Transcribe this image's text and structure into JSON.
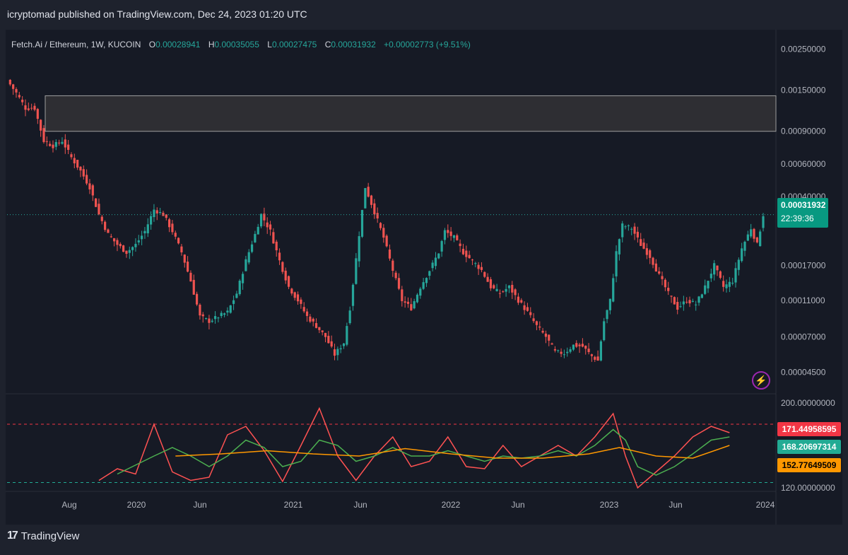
{
  "header": {
    "publisher": "icryptomad published on TradingView.com, Dec 24, 2023 01:20 UTC"
  },
  "legend": {
    "symbol": "Fetch.Ai / Ethereum, 1W, KUCOIN",
    "open_label": "O",
    "open": "0.00028941",
    "high_label": "H",
    "high": "0.00035055",
    "low_label": "L",
    "low": "0.00027475",
    "close_label": "C",
    "close": "0.00031932",
    "change": "+0.00002773 (+9.51%)"
  },
  "price_scale": {
    "last_price": "0.00031932",
    "countdown": "22:39:36"
  },
  "indicator_scale": {
    "boxes": [
      "171.44958595",
      "168.20697314",
      "152.77649509"
    ]
  },
  "footer": {
    "logo": "TradingView"
  },
  "colors": {
    "up": "#26a69a",
    "down": "#ef5350",
    "ind1": "#ff5252",
    "ind2": "#4caf50",
    "ind3": "#ff9800",
    "zone": "#2e2e33"
  },
  "chart_data": [
    {
      "type": "candlestick",
      "scale": "log",
      "ylim": [
        4e-05,
        0.0026
      ],
      "y_ticks": [
        "0.00250000",
        "0.00150000",
        "0.00090000",
        "0.00060000",
        "0.00040000",
        "0.00017000",
        "0.00011000",
        "0.00007000",
        "0.00004500"
      ],
      "x_ticks": [
        "Aug",
        "2020",
        "Jun",
        "2021",
        "Jun",
        "2022",
        "Jun",
        "2023",
        "Jun",
        "2024"
      ],
      "zone": [
        0.0009,
        0.0014
      ],
      "close_path": [
        [
          0,
          0.0017
        ],
        [
          3,
          0.00145
        ],
        [
          6,
          0.0012
        ],
        [
          9,
          0.0012
        ],
        [
          12,
          0.0008
        ],
        [
          15,
          0.00075
        ],
        [
          18,
          0.0008
        ],
        [
          21,
          0.00065
        ],
        [
          24,
          0.00055
        ],
        [
          27,
          0.00045
        ],
        [
          30,
          0.00032
        ],
        [
          33,
          0.00025
        ],
        [
          36,
          0.00022
        ],
        [
          39,
          0.0002
        ],
        [
          42,
          0.00022
        ],
        [
          45,
          0.00026
        ],
        [
          48,
          0.00034
        ],
        [
          51,
          0.00032
        ],
        [
          54,
          0.00026
        ],
        [
          57,
          0.0002
        ],
        [
          60,
          0.00014
        ],
        [
          63,
          9e-05
        ],
        [
          66,
          8.5e-05
        ],
        [
          69,
          9e-05
        ],
        [
          72,
          9.5e-05
        ],
        [
          75,
          0.00012
        ],
        [
          78,
          0.00018
        ],
        [
          81,
          0.00025
        ],
        [
          83,
          0.00032
        ],
        [
          86,
          0.00026
        ],
        [
          89,
          0.00018
        ],
        [
          92,
          0.00013
        ],
        [
          95,
          0.00011
        ],
        [
          98,
          9e-05
        ],
        [
          101,
          8e-05
        ],
        [
          104,
          7e-05
        ],
        [
          107,
          5.6e-05
        ],
        [
          110,
          6.5e-05
        ],
        [
          112,
          0.0001
        ],
        [
          115,
          0.00025
        ],
        [
          117,
          0.00045
        ],
        [
          120,
          0.00033
        ],
        [
          123,
          0.00024
        ],
        [
          126,
          0.00016
        ],
        [
          129,
          0.00011
        ],
        [
          132,
          0.0001
        ],
        [
          135,
          0.00013
        ],
        [
          138,
          0.00016
        ],
        [
          141,
          0.0002
        ],
        [
          143,
          0.00026
        ],
        [
          146,
          0.00024
        ],
        [
          149,
          0.0002
        ],
        [
          152,
          0.00018
        ],
        [
          155,
          0.00016
        ],
        [
          158,
          0.00013
        ],
        [
          161,
          0.00012
        ],
        [
          164,
          0.00013
        ],
        [
          167,
          0.00011
        ],
        [
          170,
          9.5e-05
        ],
        [
          173,
          8e-05
        ],
        [
          176,
          7e-05
        ],
        [
          179,
          5.8e-05
        ],
        [
          182,
          5.7e-05
        ],
        [
          185,
          6.3e-05
        ],
        [
          188,
          6.2e-05
        ],
        [
          191,
          5.5e-05
        ],
        [
          193,
          5.2e-05
        ],
        [
          195,
          8.5e-05
        ],
        [
          197,
          0.00011
        ],
        [
          199,
          0.0002
        ],
        [
          201,
          0.00028
        ],
        [
          204,
          0.00027
        ],
        [
          207,
          0.00022
        ],
        [
          210,
          0.00019
        ],
        [
          213,
          0.00015
        ],
        [
          216,
          0.00012
        ],
        [
          219,
          0.0001
        ],
        [
          222,
          0.00011
        ],
        [
          225,
          0.000105
        ],
        [
          228,
          0.00013
        ],
        [
          231,
          0.00017
        ],
        [
          234,
          0.00013
        ],
        [
          237,
          0.00014
        ],
        [
          240,
          0.00021
        ],
        [
          243,
          0.00027
        ],
        [
          245,
          0.00022
        ],
        [
          247,
          0.00031932
        ]
      ],
      "last": 0.00031932
    },
    {
      "type": "line",
      "ylim": [
        120,
        200
      ],
      "y_ticks": [
        "200.00000000",
        "120.00000000"
      ],
      "levels": [
        180,
        125
      ],
      "series": [
        {
          "color": "#ff5252",
          "values": [
            [
              30,
              127
            ],
            [
              36,
              138
            ],
            [
              42,
              133
            ],
            [
              48,
              180
            ],
            [
              54,
              135
            ],
            [
              60,
              127
            ],
            [
              66,
              130
            ],
            [
              72,
              170
            ],
            [
              78,
              178
            ],
            [
              84,
              155
            ],
            [
              90,
              126
            ],
            [
              96,
              160
            ],
            [
              102,
              195
            ],
            [
              108,
              150
            ],
            [
              114,
              127
            ],
            [
              120,
              150
            ],
            [
              126,
              168
            ],
            [
              132,
              140
            ],
            [
              138,
              145
            ],
            [
              144,
              168
            ],
            [
              150,
              140
            ],
            [
              156,
              138
            ],
            [
              162,
              160
            ],
            [
              168,
              140
            ],
            [
              174,
              150
            ],
            [
              180,
              160
            ],
            [
              186,
              150
            ],
            [
              192,
              168
            ],
            [
              198,
              190
            ],
            [
              202,
              150
            ],
            [
              206,
              120
            ],
            [
              212,
              135
            ],
            [
              218,
              150
            ],
            [
              224,
              168
            ],
            [
              230,
              178
            ],
            [
              236,
              172
            ]
          ]
        },
        {
          "color": "#4caf50",
          "values": [
            [
              36,
              133
            ],
            [
              48,
              150
            ],
            [
              54,
              158
            ],
            [
              60,
              150
            ],
            [
              66,
              140
            ],
            [
              72,
              150
            ],
            [
              78,
              165
            ],
            [
              84,
              158
            ],
            [
              90,
              140
            ],
            [
              96,
              145
            ],
            [
              102,
              165
            ],
            [
              108,
              160
            ],
            [
              114,
              145
            ],
            [
              120,
              150
            ],
            [
              126,
              158
            ],
            [
              132,
              150
            ],
            [
              138,
              150
            ],
            [
              144,
              155
            ],
            [
              150,
              150
            ],
            [
              156,
              145
            ],
            [
              162,
              150
            ],
            [
              168,
              148
            ],
            [
              174,
              150
            ],
            [
              180,
              155
            ],
            [
              186,
              150
            ],
            [
              192,
              160
            ],
            [
              198,
              175
            ],
            [
              202,
              165
            ],
            [
              206,
              140
            ],
            [
              212,
              132
            ],
            [
              218,
              140
            ],
            [
              224,
              152
            ],
            [
              230,
              165
            ],
            [
              236,
              168
            ]
          ]
        },
        {
          "color": "#ff9800",
          "values": [
            [
              55,
              150
            ],
            [
              70,
              152
            ],
            [
              85,
              155
            ],
            [
              100,
              152
            ],
            [
              115,
              150
            ],
            [
              130,
              157
            ],
            [
              145,
              152
            ],
            [
              160,
              148
            ],
            [
              175,
              148
            ],
            [
              190,
              152
            ],
            [
              200,
              158
            ],
            [
              212,
              150
            ],
            [
              224,
              148
            ],
            [
              236,
              160
            ]
          ]
        }
      ]
    }
  ]
}
